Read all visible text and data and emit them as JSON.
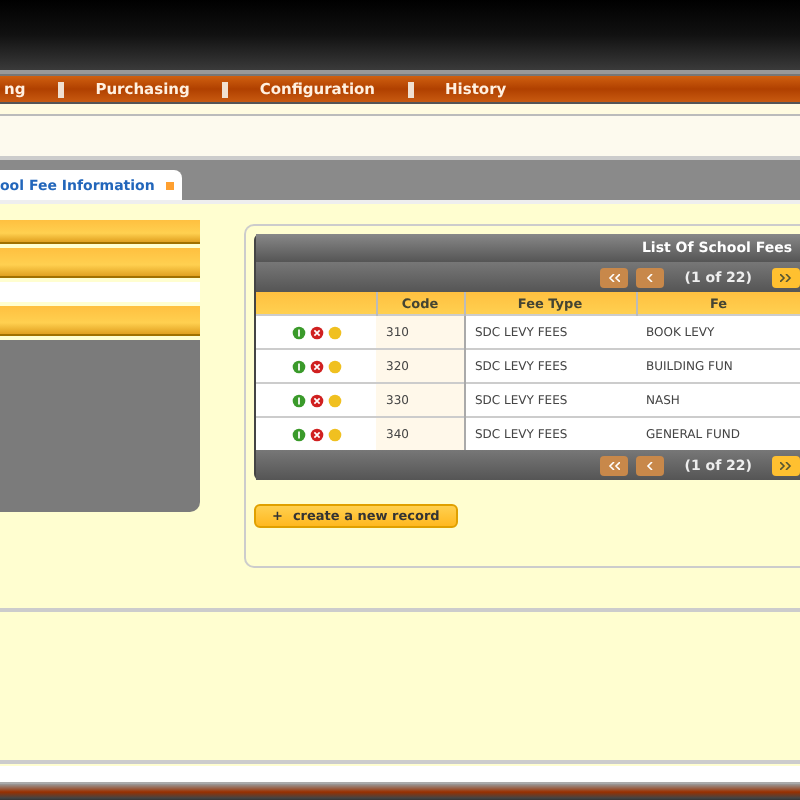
{
  "menu": [
    {
      "label": "ng"
    },
    {
      "label": "Purchasing"
    },
    {
      "label": "Configuration"
    },
    {
      "label": "History"
    }
  ],
  "tabs": [
    {
      "label": "ool Fee Information",
      "selected": true
    }
  ],
  "table": {
    "title": "List Of School Fees",
    "pager_text": "(1 of 22)",
    "columns": [
      "Code",
      "Fee Type",
      "Fe"
    ],
    "rows": [
      {
        "cells": [
          "310",
          "SDC LEVY FEES",
          "BOOK LEVY"
        ]
      },
      {
        "cells": [
          "320",
          "SDC LEVY FEES",
          "BUILDING FUN"
        ]
      },
      {
        "cells": [
          "330",
          "SDC LEVY FEES",
          "NASH"
        ]
      },
      {
        "cells": [
          "340",
          "SDC LEVY FEES",
          "GENERAL FUND"
        ]
      }
    ],
    "bottom_pager_text": "(1 of 22)"
  },
  "create_button": {
    "icon": "+",
    "label": "create a new record"
  }
}
